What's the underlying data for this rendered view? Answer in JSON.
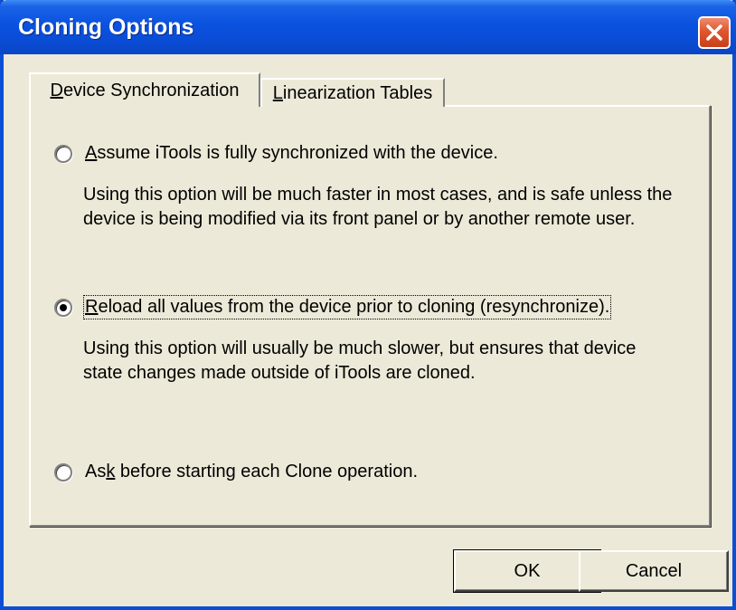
{
  "window": {
    "title": "Cloning Options"
  },
  "tabs": [
    {
      "label_mnemonic": "D",
      "label_rest": "evice Synchronization",
      "selected": true
    },
    {
      "label_mnemonic": "L",
      "label_rest": "inearization Tables",
      "selected": false
    }
  ],
  "options": [
    {
      "label_pre": "",
      "label_mnemonic": "A",
      "label_post": "ssume iTools is fully synchronized with the device.",
      "selected": false,
      "description_line1": "Using this option will be much faster in most cases, and is safe unless the",
      "description_line2": "device is being modified via its front panel or by another remote user."
    },
    {
      "label_pre": "",
      "label_mnemonic": "R",
      "label_post": "eload all values from the device prior to cloning (resynchronize).",
      "selected": true,
      "description_line1": "Using this option will usually be much slower, but ensures that device",
      "description_line2": "state changes made outside of iTools are cloned."
    },
    {
      "label_pre": "As",
      "label_mnemonic": "k",
      "label_post": " before starting each Clone operation.",
      "selected": false
    }
  ],
  "buttons": {
    "ok_label": "OK",
    "cancel_label": "Cancel"
  },
  "icons": {
    "close": "close-icon"
  },
  "colors": {
    "titlebar": "#0a52e0",
    "close_button": "#e0562e",
    "dialog_face": "#ece9d8"
  }
}
